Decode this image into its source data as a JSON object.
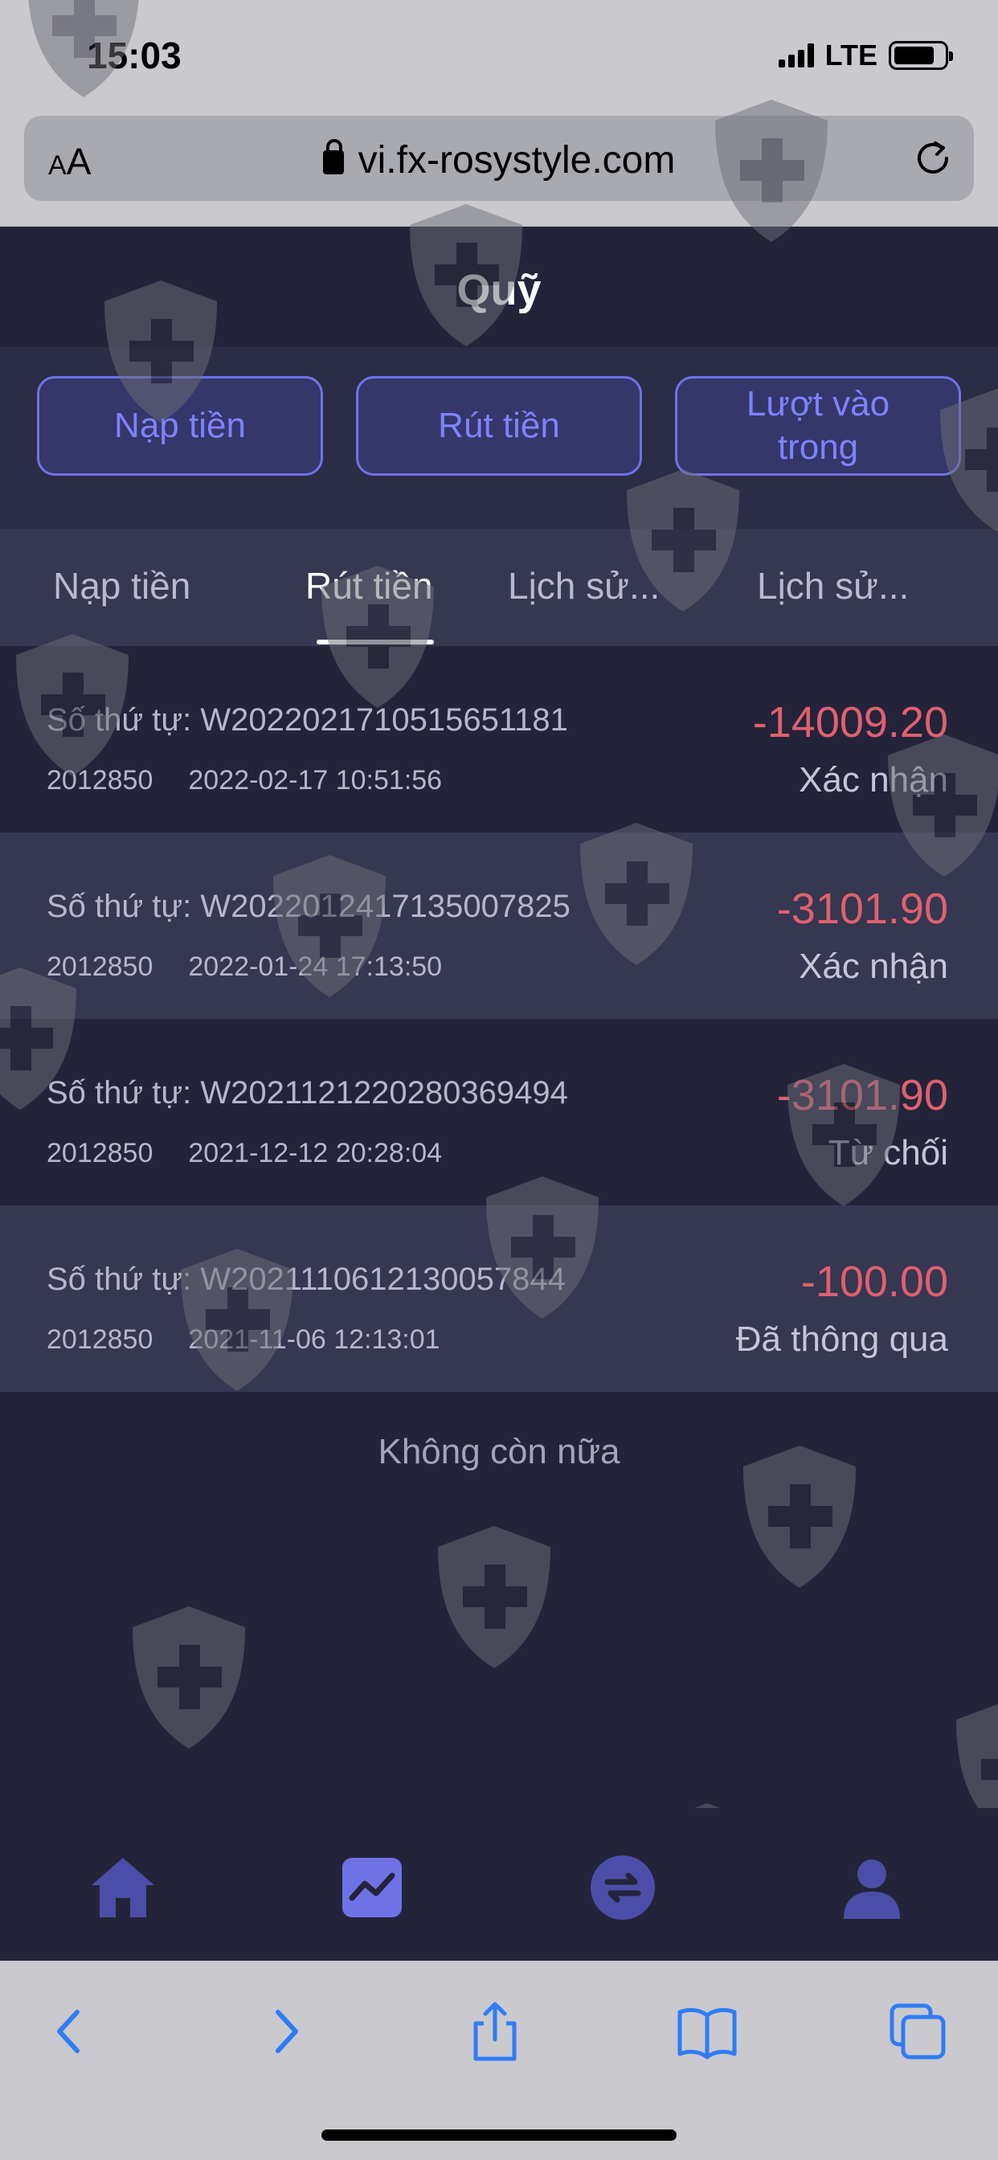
{
  "status_bar": {
    "time": "15:03",
    "network": "LTE"
  },
  "browser": {
    "text_size_button": {
      "small": "A",
      "large": "A"
    },
    "url": "vi.fx-rosystyle.com"
  },
  "header": {
    "title": "Quỹ"
  },
  "actions": {
    "deposit_label": "Nạp tiền",
    "withdraw_label": "Rút tiền",
    "entries_label_line1": "Lượt vào",
    "entries_label_line2": "trong"
  },
  "tabs": [
    {
      "label": "Nạp tiền",
      "active": false
    },
    {
      "label": "Rút tiền",
      "active": true
    },
    {
      "label": "Lịch sử...",
      "active": false
    },
    {
      "label": "Lịch sử...",
      "active": false
    }
  ],
  "records": [
    {
      "order_prefix": "Số thứ tự:",
      "order_no": "W2022021710515651181",
      "account": "2012850",
      "datetime": "2022-02-17 10:51:56",
      "amount": "-14009.20",
      "status": "Xác nhận"
    },
    {
      "order_prefix": "Số thứ tự:",
      "order_no": "W2022012417135007825",
      "account": "2012850",
      "datetime": "2022-01-24 17:13:50",
      "amount": "-3101.90",
      "status": "Xác nhận"
    },
    {
      "order_prefix": "Số thứ tự:",
      "order_no": "W2021121220280369494",
      "account": "2012850",
      "datetime": "2021-12-12 20:28:04",
      "amount": "-3101.90",
      "status": "Từ chối"
    },
    {
      "order_prefix": "Số thứ tự:",
      "order_no": "W2021110612130057844",
      "account": "2012850",
      "datetime": "2021-11-06 12:13:01",
      "amount": "-100.00",
      "status": "Đã thông qua"
    }
  ],
  "list_end_text": "Không còn nữa",
  "bottom_nav": [
    "home-icon",
    "chart-icon",
    "exchange-icon",
    "user-icon"
  ],
  "browser_toolbar": [
    "back-icon",
    "forward-icon",
    "share-icon",
    "bookmarks-icon",
    "tabs-icon"
  ],
  "colors": {
    "accent": "#6f72e6",
    "negative_amount": "#e0606f",
    "background": "#23243a"
  }
}
